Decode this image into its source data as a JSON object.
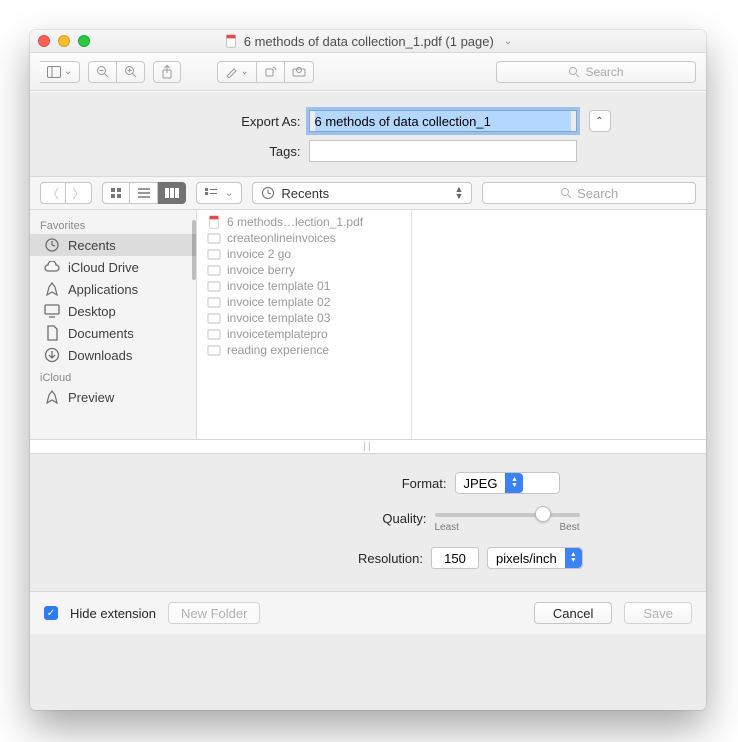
{
  "titlebar": {
    "title": "6 methods of data collection_1.pdf (1 page)"
  },
  "toolbar": {
    "search_placeholder": "Search"
  },
  "export": {
    "export_as_label": "Export As:",
    "export_as_value": "6 methods of data collection_1",
    "tags_label": "Tags:",
    "tags_value": ""
  },
  "browser": {
    "location": "Recents",
    "search_placeholder": "Search",
    "sidebar_sections": [
      {
        "header": "Favorites",
        "items": [
          {
            "icon": "clock",
            "label": "Recents",
            "active": true
          },
          {
            "icon": "cloud",
            "label": "iCloud Drive"
          },
          {
            "icon": "apps",
            "label": "Applications"
          },
          {
            "icon": "desktop",
            "label": "Desktop"
          },
          {
            "icon": "doc",
            "label": "Documents"
          },
          {
            "icon": "download",
            "label": "Downloads"
          }
        ]
      },
      {
        "header": "iCloud",
        "items": [
          {
            "icon": "apps",
            "label": "Preview"
          }
        ]
      }
    ],
    "files": [
      {
        "icon": "pdf",
        "label": "6 methods…lection_1.pdf"
      },
      {
        "icon": "folder",
        "label": "createonlineinvoices"
      },
      {
        "icon": "folder",
        "label": "invoice 2 go"
      },
      {
        "icon": "folder",
        "label": "invoice berry"
      },
      {
        "icon": "folder",
        "label": "invoice template 01"
      },
      {
        "icon": "folder",
        "label": "invoice template 02"
      },
      {
        "icon": "folder",
        "label": "invoice template 03"
      },
      {
        "icon": "folder",
        "label": "invoicetemplatepro"
      },
      {
        "icon": "folder",
        "label": "reading experience"
      }
    ]
  },
  "options": {
    "format_label": "Format:",
    "format_value": "JPEG",
    "quality_label": "Quality:",
    "quality_least": "Least",
    "quality_best": "Best",
    "resolution_label": "Resolution:",
    "resolution_value": "150",
    "resolution_unit": "pixels/inch"
  },
  "footer": {
    "hide_ext_label": "Hide extension",
    "new_folder_label": "New Folder",
    "cancel_label": "Cancel",
    "save_label": "Save"
  }
}
